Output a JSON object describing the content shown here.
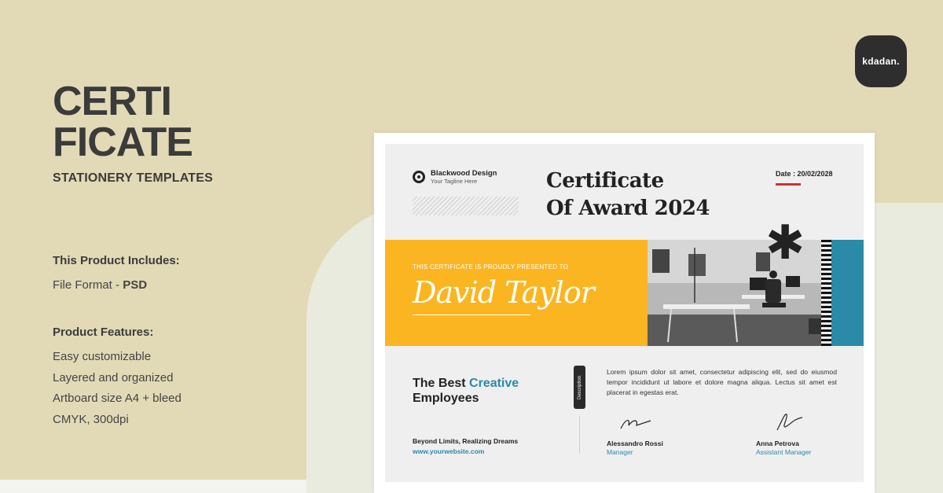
{
  "left_panel": {
    "title_line1": "CERTI",
    "title_line2": "FICATE",
    "subtitle": "STATIONERY TEMPLATES",
    "includes_heading": "This Product Includes:",
    "file_format_label": "File Format - ",
    "file_format_value": "PSD",
    "features_heading": "Product Features:",
    "features": [
      "Easy customizable",
      "Layered and organized",
      "Artboard size A4 + bleed",
      "CMYK, 300dpi"
    ]
  },
  "brand": {
    "logo_text": "kdadan."
  },
  "certificate": {
    "company_name": "Blackwood Design",
    "company_tagline": "Your Tagline Here",
    "title_line1": "Certificate",
    "title_line2": "Of Award 2024",
    "date": "Date : 20/02/2028",
    "presented_text": "THIS CERTIFICATE IS PROUDLY PRESENTED TO",
    "recipient": "David Taylor",
    "award_prefix": "The Best ",
    "award_highlight": "Creative",
    "award_line2": "Employees",
    "tab_label": "Description",
    "description": "Lorem ipsum dolor sit amet, consectetur adipiscing elit, sed do eiusmod tempor incididunt ut labore et dolore magna aliqua. Lectus sit amet est placerat in egestas erat.",
    "motto": "Beyond Limits, Realizing Dreams",
    "website": "www.yourwebsite.com",
    "signer1_name": "Alessandro Rossi",
    "signer1_role": "Manager",
    "signer2_name": "Anna Petrova",
    "signer2_role": "Assistant Manager"
  },
  "colors": {
    "background": "#e2dab6",
    "accent_yellow": "#fbb521",
    "accent_blue": "#2a8aa8",
    "date_underline": "#d42f2f"
  }
}
